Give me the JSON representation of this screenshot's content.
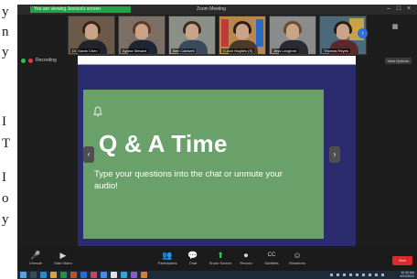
{
  "paper": {
    "letters": [
      "y",
      "n",
      "y",
      "I",
      "T",
      "I",
      "o",
      "y"
    ]
  },
  "window": {
    "banner_text": "You are viewing Jessica's screen",
    "title": "Zoom Meeting"
  },
  "participants": [
    {
      "name": "Dr. Sarah Chen",
      "bg": "#6b5a4a",
      "hair": "#3a2418",
      "shirt": "#23232b"
    },
    {
      "name": "Ayana Stewart",
      "bg": "#7b6f66",
      "hair": "#5a3a24",
      "shirt": "#1f2633"
    },
    {
      "name": "Ben Caldwell",
      "bg": "#8c8f86",
      "hair": "#3b2d22",
      "shirt": "#394a5a"
    },
    {
      "name": "C.Ann Hughes (S)",
      "bg": "#b8864e",
      "hair": "#2b1c14",
      "shirt": "#4a3a2a"
    },
    {
      "name": "Jess Langford",
      "bg": "#8b8b8b",
      "hair": "#6b4a2a",
      "shirt": "#2a2a33"
    },
    {
      "name": "Thomas Reyes",
      "bg": "#4b6b7c",
      "hair": "#2a1d15",
      "shirt": "#5a2a2a"
    }
  ],
  "recording": {
    "label": "Recording",
    "view_options": "View Options"
  },
  "slide": {
    "title": "Q & A Time",
    "body": "Type your questions into the chat or unmute your audio!",
    "prev": "‹",
    "next": "›",
    "controls": "⤢   ⛶"
  },
  "toolbar": [
    {
      "icon": "🎤",
      "label": "Unmute",
      "name": "unmute-button",
      "icon_name": "microphone-icon"
    },
    {
      "icon": "▶",
      "label": "Start Video",
      "name": "start-video-button",
      "icon_name": "video-camera-icon"
    },
    {
      "icon": "👥",
      "label": "Participants",
      "name": "participants-button",
      "icon_name": "participants-icon"
    },
    {
      "icon": "💬",
      "label": "Chat",
      "name": "chat-button",
      "icon_name": "chat-icon"
    },
    {
      "icon": "⬆",
      "label": "Share Screen",
      "name": "share-screen-button",
      "icon_name": "share-screen-icon"
    },
    {
      "icon": "⏺",
      "label": "Record",
      "name": "record-button",
      "icon_name": "record-icon"
    },
    {
      "icon": "CC",
      "label": "Subtitles",
      "name": "subtitles-button",
      "icon_name": "captions-icon"
    },
    {
      "icon": "☺",
      "label": "Reactions",
      "name": "reactions-button",
      "icon_name": "reactions-icon"
    }
  ],
  "end_label": "End",
  "clock": {
    "time": "10:42 AM",
    "date": "4/21/2021"
  },
  "colors": {
    "share_accent": "#1ea54a",
    "slide_bg": "#6aa16a",
    "share_bg": "#2b2c6e",
    "end_red": "#d92b2b"
  }
}
